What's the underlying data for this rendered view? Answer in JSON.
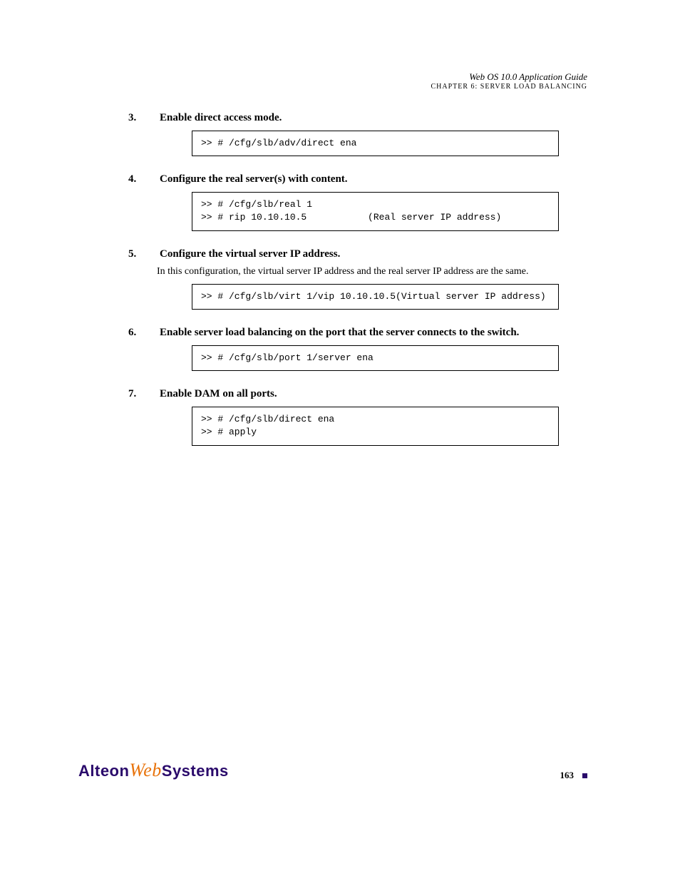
{
  "header": {
    "guide_title": "Web OS 10.0 Application Guide",
    "chapter_small": "CHAPTER 6: SERVER LOAD BALANCING"
  },
  "steps": [
    {
      "num": "3.",
      "text": "Enable direct access mode.",
      "code": ">> # /cfg/slb/adv/direct ena"
    },
    {
      "num": "4.",
      "text": "Configure the real server(s) with content.",
      "code": ">> # /cfg/slb/real 1\n>> # rip 10.10.10.5           (Real server IP address)"
    },
    {
      "num": "5.",
      "text": "Configure the virtual server IP address.",
      "note": "In this configuration, the virtual server IP address and the real server IP address are the same.",
      "code": ">> # /cfg/slb/virt 1/vip 10.10.10.5(Virtual server IP address)"
    },
    {
      "num": "6.",
      "text": "Enable server load balancing on the port that the server connects to the switch.",
      "code": ">> # /cfg/slb/port 1/server ena"
    },
    {
      "num": "7.",
      "text": "Enable DAM on all ports.",
      "code": ">> # /cfg/slb/direct ena\n>> # apply"
    }
  ],
  "footer": {
    "page_num": "163",
    "logo": {
      "part1": "Alteon",
      "part2": "Web",
      "part3": "Systems"
    }
  }
}
